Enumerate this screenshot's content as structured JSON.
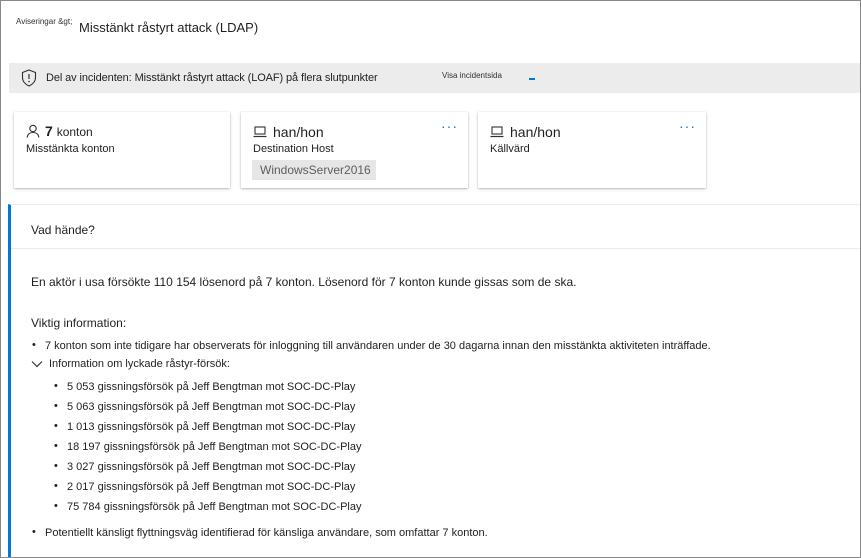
{
  "header": {
    "breadcrumb": "Aviseringar &gt;",
    "title": "Misstänkt råstyrt attack (LDAP)"
  },
  "banner": {
    "icon": "shield-icon",
    "text": "Del av incidenten: Misstänkt råstyrt attack (LOAF) på flera slutpunkter",
    "link": "Visa incidentsida"
  },
  "cards": [
    {
      "icon": "person-icon",
      "value": "7",
      "unit": "konton",
      "label": "Misstänkta konton"
    },
    {
      "icon": "laptop-icon",
      "value": "han/hon",
      "label": "Destination Host",
      "tag": "WindowsServer2016",
      "more": "···"
    },
    {
      "icon": "laptop-icon",
      "value": "han/hon",
      "label": "Källvärd",
      "more": "···"
    }
  ],
  "panel": {
    "heading": "Vad hände?",
    "summary": "En aktör i usa försökte 110 154 lösenord på 7 konton. Lösenord för 7 konton kunde gissas som de ska.",
    "key_info_label": "Viktig information:",
    "bullet1": "7 konton som inte tidigare har observerats för inloggning till användaren under de 30 dagarna innan den misstänkta aktiviteten inträffade.",
    "expander_label": "Information om lyckade råstyr-försök:",
    "attempts": [
      "5 053 gissningsförsök på Jeff Bengtman mot SOC-DC-Play",
      "5 063 gissningsförsök på Jeff Bengtman mot SOC-DC-Play",
      "1 013 gissningsförsök på Jeff Bengtman mot SOC-DC-Play",
      "18 197 gissningsförsök på Jeff Bengtman mot SOC-DC-Play",
      "3 027 gissningsförsök på Jeff Bengtman mot SOC-DC-Play",
      "2 017 gissningsförsök på Jeff Bengtman mot SOC-DC-Play",
      "75 784 gissningsförsök på Jeff Bengtman mot SOC-DC-Play"
    ],
    "bullet_last": "Potentiellt känsligt flyttningsväg identifierad för känsliga användare, som omfattar 7 konton."
  },
  "colors": {
    "accent": "#0078d4",
    "banner_bg": "#ececec",
    "tag_bg": "#e6e6e6"
  }
}
